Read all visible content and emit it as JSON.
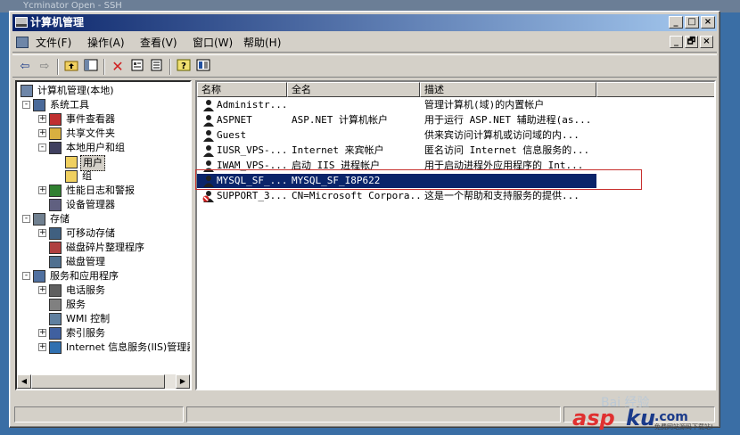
{
  "background_title": "Ycminator Open - SSH",
  "window": {
    "title": "计算机管理",
    "caption_buttons": [
      "_",
      "□",
      "×"
    ]
  },
  "menu": {
    "items": [
      "文件(F)",
      "操作(A)",
      "查看(V)",
      "窗口(W)",
      "帮助(H)"
    ],
    "mdi_buttons": [
      "_",
      "🗗",
      "×"
    ]
  },
  "tree": {
    "items": [
      {
        "label": "计算机管理(本地)",
        "icon": "computer-management-icon"
      },
      {
        "label": "系统工具",
        "icon": "system-tools-icon"
      },
      {
        "label": "事件查看器",
        "icon": "event-viewer-icon"
      },
      {
        "label": "共享文件夹",
        "icon": "shared-folders-icon"
      },
      {
        "label": "本地用户和组",
        "icon": "local-users-groups-icon"
      },
      {
        "label": "用户",
        "icon": "folder-open-icon"
      },
      {
        "label": "组",
        "icon": "folder-icon"
      },
      {
        "label": "性能日志和警报",
        "icon": "performance-logs-icon"
      },
      {
        "label": "设备管理器",
        "icon": "device-manager-icon"
      },
      {
        "label": "存储",
        "icon": "storage-icon"
      },
      {
        "label": "可移动存储",
        "icon": "removable-storage-icon"
      },
      {
        "label": "磁盘碎片整理程序",
        "icon": "defragmenter-icon"
      },
      {
        "label": "磁盘管理",
        "icon": "disk-management-icon"
      },
      {
        "label": "服务和应用程序",
        "icon": "services-applications-icon"
      },
      {
        "label": "电话服务",
        "icon": "telephony-icon"
      },
      {
        "label": "服务",
        "icon": "services-icon"
      },
      {
        "label": "WMI 控制",
        "icon": "wmi-control-icon"
      },
      {
        "label": "索引服务",
        "icon": "indexing-service-icon"
      },
      {
        "label": "Internet 信息服务(IIS)管理器",
        "icon": "iis-manager-icon"
      }
    ]
  },
  "list": {
    "columns": [
      "名称",
      "全名",
      "描述"
    ],
    "rows": [
      {
        "name": "Administr...",
        "fullname": "",
        "description": "管理计算机(域)的内置帐户"
      },
      {
        "name": "ASPNET",
        "fullname": "ASP.NET 计算机帐户",
        "description": "用于运行 ASP.NET 辅助进程(as..."
      },
      {
        "name": "Guest",
        "fullname": "",
        "description": "供来宾访问计算机或访问域的内..."
      },
      {
        "name": "IUSR_VPS-...",
        "fullname": "Internet 来宾帐户",
        "description": "匿名访问 Internet 信息服务的..."
      },
      {
        "name": "IWAM_VPS-...",
        "fullname": "启动 IIS 进程帐户",
        "description": "用于启动进程外应用程序的 Int..."
      },
      {
        "name": "MYSQL_SF_...",
        "fullname": "MYSQL_SF_I8P622",
        "description": ""
      },
      {
        "name": "SUPPORT_3...",
        "fullname": "CN=Microsoft Corpora...",
        "description": "这是一个帮助和支持服务的提供..."
      }
    ]
  },
  "watermark": {
    "text1": "Bai 经验",
    "text2": "asp",
    "text3": "ku",
    "text4": ".com",
    "text5": "免费网站源码下载站!"
  },
  "colors": {
    "selection": "#0a246a",
    "highlight_box": "#c8302e",
    "titlebar_start": "#0a246a",
    "titlebar_end": "#a6caf0"
  }
}
